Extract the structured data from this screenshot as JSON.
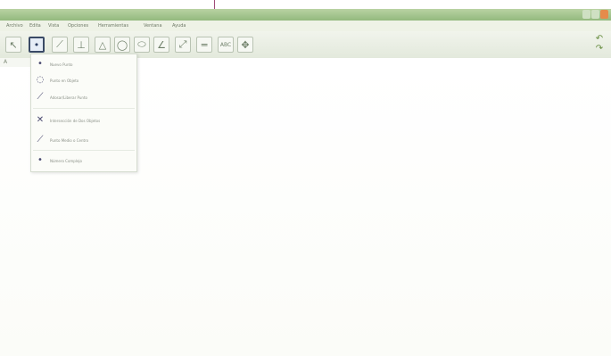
{
  "window": {
    "title": ""
  },
  "menubar": {
    "items": [
      {
        "label": "Archivo"
      },
      {
        "label": "Edita"
      },
      {
        "label": "Vista"
      },
      {
        "label": "Opciones"
      },
      {
        "label": "Herramientas"
      },
      {
        "label": "Ventana"
      },
      {
        "label": "Ayuda"
      }
    ]
  },
  "toolbar": {
    "tools": [
      {
        "name": "move-tool",
        "icon": "↖",
        "active": false
      },
      {
        "name": "point-tool",
        "icon": "•",
        "active": true
      },
      {
        "name": "line-tool",
        "icon": "⟋",
        "active": false
      },
      {
        "name": "perpendicular-line-tool",
        "icon": "⊥",
        "active": false
      },
      {
        "name": "polygon-tool",
        "icon": "△",
        "active": false
      },
      {
        "name": "circle-tool",
        "icon": "◯",
        "active": false
      },
      {
        "name": "ellipse-tool",
        "icon": "⬭",
        "active": false
      },
      {
        "name": "angle-tool",
        "icon": "∠",
        "active": false
      },
      {
        "name": "reflect-tool",
        "icon": "⤢",
        "active": false
      },
      {
        "name": "slider-tool",
        "icon": "═",
        "active": false
      },
      {
        "name": "text-tool",
        "icon": "ABC",
        "active": false
      },
      {
        "name": "move-graphics-view-tool",
        "icon": "✥",
        "active": false
      }
    ]
  },
  "algebra": {
    "label": "A"
  },
  "dropdown": {
    "items": [
      {
        "label": "Nuevo Punto",
        "icon": "•"
      },
      {
        "label": "Punto en Objeto",
        "icon": "◌"
      },
      {
        "label": "Adosar/Liberar Punto",
        "icon": "⟋"
      },
      {
        "label": "Intersección de Dos Objetos",
        "icon": "✕"
      },
      {
        "label": "Punto Medio o Centro",
        "icon": "⟋"
      },
      {
        "label": "Número Complejo",
        "icon": "•"
      }
    ]
  }
}
